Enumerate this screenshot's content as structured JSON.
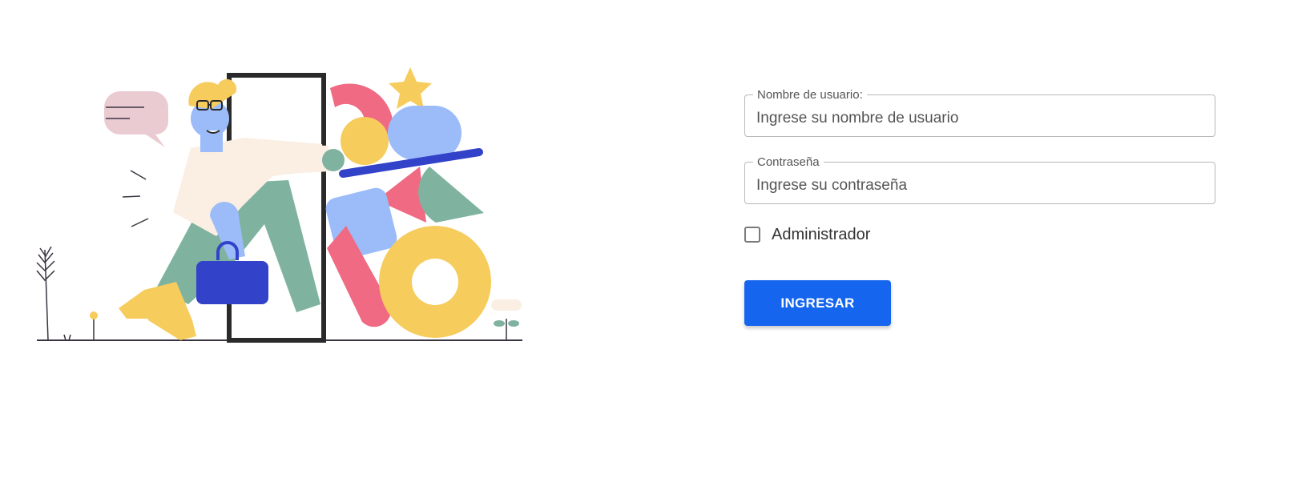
{
  "form": {
    "username": {
      "label": "Nombre de usuario:",
      "placeholder": "Ingrese su nombre de usuario",
      "value": ""
    },
    "password": {
      "label": "Contraseña",
      "placeholder": "Ingrese su contraseña",
      "value": ""
    },
    "admin_checkbox": {
      "label": "Administrador",
      "checked": false
    },
    "submit_label": "INGRESAR"
  },
  "colors": {
    "accent": "#1565ee",
    "border": "#b8b8b8",
    "text": "#333333",
    "label": "#555555"
  },
  "illustration": {
    "subject": "person-walking-through-door-with-shapes-illustration"
  }
}
